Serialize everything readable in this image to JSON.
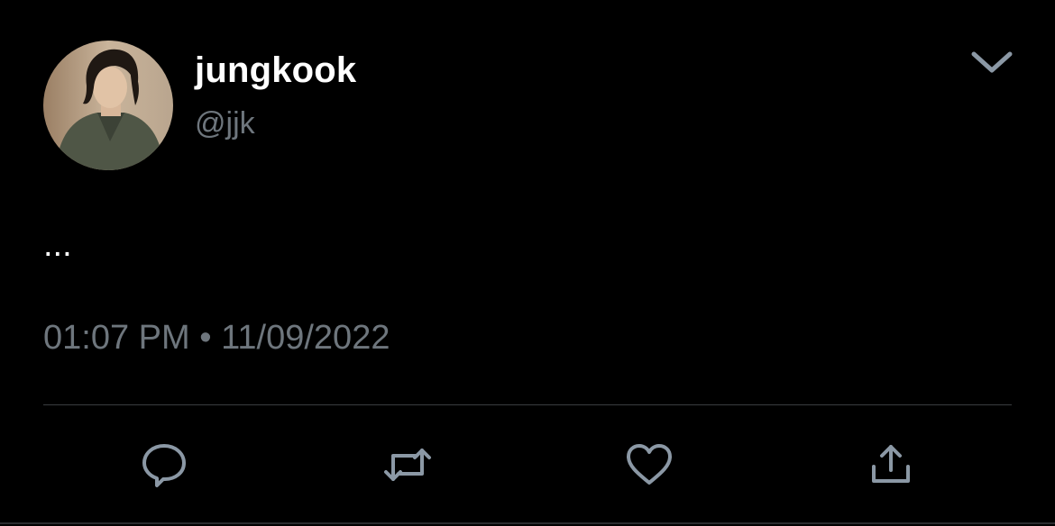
{
  "tweet": {
    "display_name": "jungkook",
    "handle": "@jjk",
    "text": "...",
    "time": "01:07 PM",
    "separator": "•",
    "date": "11/09/2022"
  },
  "icons": {
    "menu": "chevron-down-icon",
    "reply": "reply-bubble-icon",
    "retweet": "retweet-icon",
    "like": "heart-icon",
    "share": "share-icon"
  },
  "colors": {
    "background": "#000000",
    "primary_text": "#ffffff",
    "secondary_text": "#6e767d",
    "icon": "#8b98a5",
    "divider": "#3a3d40"
  }
}
